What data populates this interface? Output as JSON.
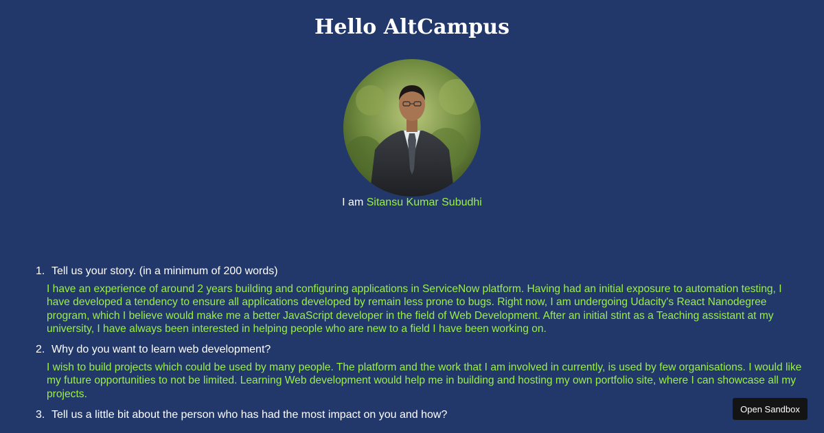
{
  "header": {
    "title": "Hello AltCampus"
  },
  "profile": {
    "intro_prefix": "I am",
    "name": "Sitansu Kumar Subudhi",
    "avatar_description": "circular profile photo of a man in a dark suit outdoors"
  },
  "qa": [
    {
      "number": "1.",
      "question": "Tell us your story. (in a minimum of 200 words)",
      "answer": "I have an experience of around 2 years building and configuring applications in ServiceNow platform. Having had an initial exposure to automation testing, I have developed a tendency to ensure all applications developed by remain less prone to bugs. Right now, I am undergoing Udacity's React Nanodegree program, which I believe would make me a better JavaScript developer in the field of Web Development. After an initial stint as a Teaching assistant at my university, I have always been interested in helping people who are new to a field I have been working on."
    },
    {
      "number": "2.",
      "question": "Why do you want to learn web development?",
      "answer": "I wish to build projects which could be used by many people. The platform and the work that I am involved in currently, is used by few organisations. I would like my future opportunities to not be limited. Learning Web development would help me in building and hosting my own portfolio site, where I can showcase all my projects."
    },
    {
      "number": "3.",
      "question": "Tell us a little bit about the person who has had the most impact on you and how?",
      "answer": ""
    }
  ],
  "sandbox": {
    "button_label": "Open Sandbox"
  },
  "colors": {
    "background": "#22386b",
    "accent_green": "#9bf047",
    "text": "#ffffff",
    "sandbox_button": "#141414"
  }
}
